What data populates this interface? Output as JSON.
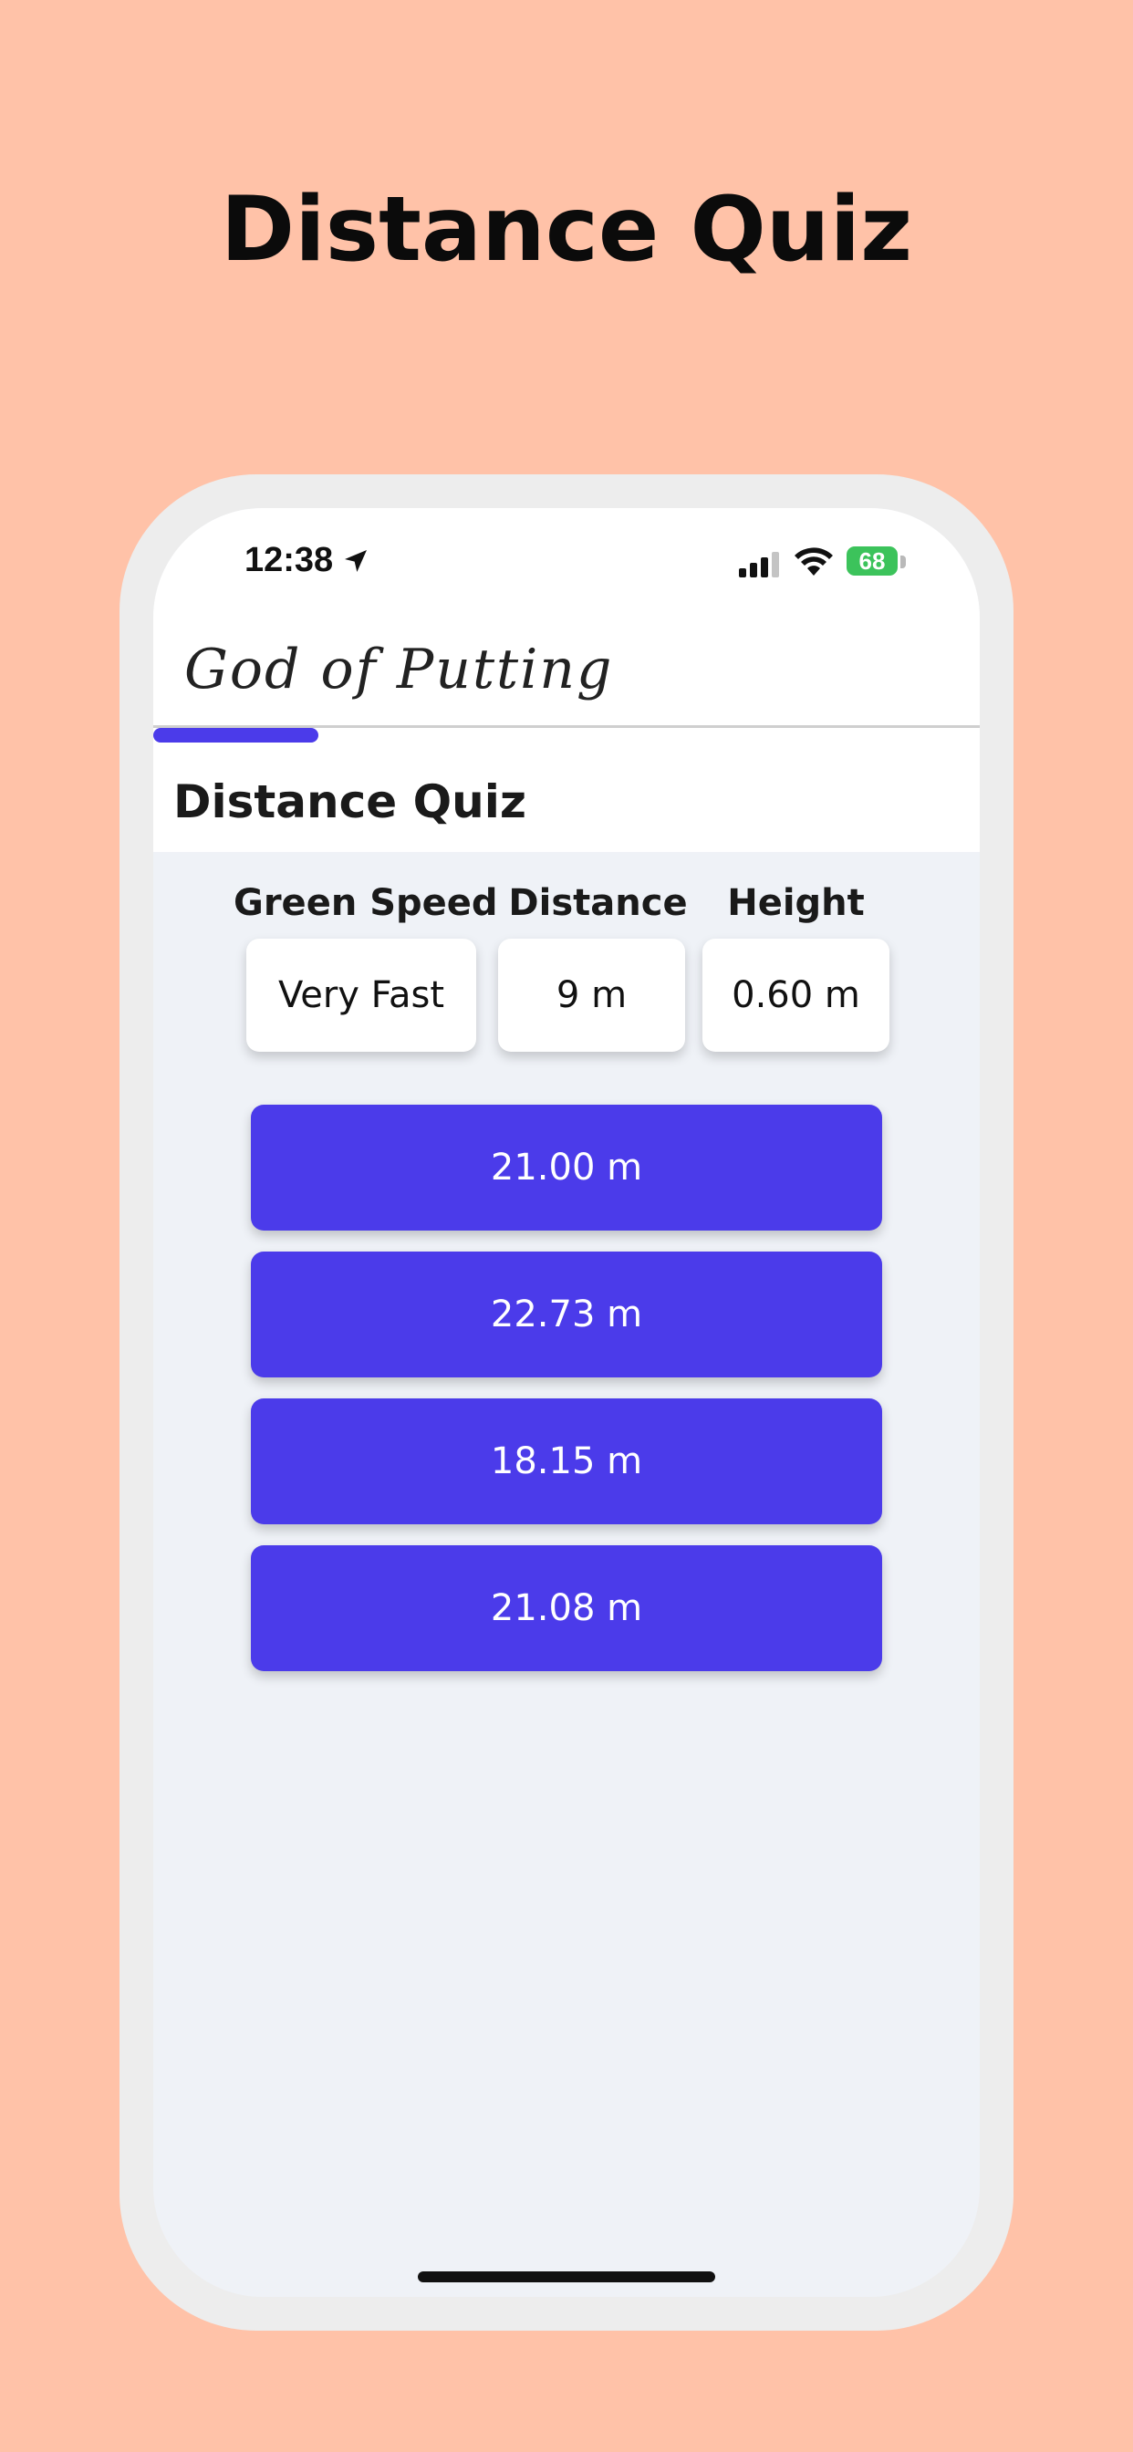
{
  "promo": {
    "title": "Distance Quiz"
  },
  "status_bar": {
    "time": "12:38",
    "battery": "68",
    "icons": [
      "location-arrow-icon",
      "cellular-signal-icon",
      "wifi-icon",
      "battery-icon"
    ]
  },
  "app": {
    "title": "God of Putting"
  },
  "progress": {
    "fraction": 0.2
  },
  "section": {
    "title": "Distance Quiz"
  },
  "params": {
    "green_speed": {
      "label": "Green Speed",
      "value": "Very Fast"
    },
    "distance": {
      "label": "Distance",
      "value": "9 m"
    },
    "height": {
      "label": "Height",
      "value": "0.60 m"
    }
  },
  "answers": [
    "21.00 m",
    "22.73 m",
    "18.15 m",
    "21.08 m"
  ],
  "colors": {
    "background": "#FFC2A8",
    "accent": "#4B3BEA",
    "screen_bg": "#EFF2F7"
  }
}
